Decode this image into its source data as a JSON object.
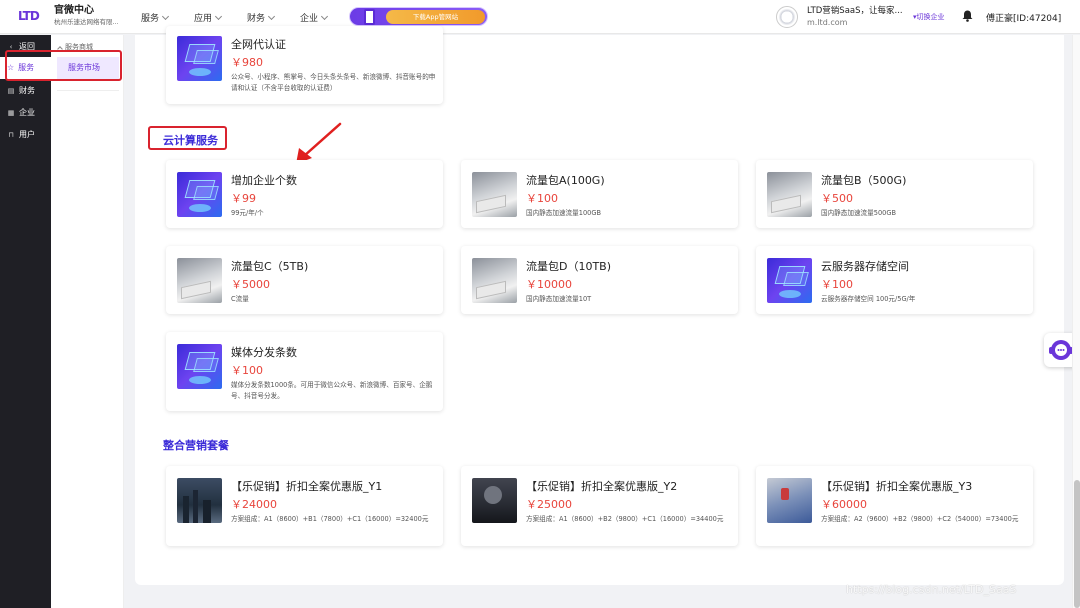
{
  "header": {
    "logo_text": "LTD",
    "title": "官微中心",
    "company_short": "杭州乐速达网络有限...",
    "nav": [
      {
        "label": "服务"
      },
      {
        "label": "应用"
      },
      {
        "label": "财务"
      },
      {
        "label": "企业"
      }
    ],
    "app_banner": "下载App管网站",
    "company_name": "LTD营销SaaS，让每家...",
    "company_domain": "m.ltd.com",
    "switch_label": "▾切换企业",
    "user": "傅正豪[ID:47204]"
  },
  "sidebar": {
    "back_label": "返回",
    "items": [
      {
        "label": "服务",
        "icon": "star-icon"
      },
      {
        "label": "财务",
        "icon": "wallet-icon"
      },
      {
        "label": "企业",
        "icon": "building-icon"
      },
      {
        "label": "用户",
        "icon": "bookmark-icon"
      }
    ]
  },
  "subsidebar": {
    "group": "服务商城",
    "active": "服务市场"
  },
  "sections": {
    "cloud_title": "云计算服务",
    "bundle_title": "整合营销套餐"
  },
  "cards": {
    "cert": {
      "title": "全网代认证",
      "price": "￥980",
      "desc": "公众号、小程序、熊掌号、今日头条头条号、新浪微博、抖音账号的申请和认证（不含平台收取的认证费）"
    },
    "enterprise": {
      "title": "增加企业个数",
      "price": "￥99",
      "desc": "99元/年/个"
    },
    "flow_a": {
      "title": "流量包A(100G)",
      "price": "￥100",
      "desc": "国内静态加速流量100GB"
    },
    "flow_b": {
      "title": "流量包B（500G)",
      "price": "￥500",
      "desc": "国内静态加速流量500GB"
    },
    "flow_c": {
      "title": "流量包C（5TB)",
      "price": "￥5000",
      "desc": "C流量"
    },
    "flow_d": {
      "title": "流量包D（10TB)",
      "price": "￥10000",
      "desc": "国内静态加速流量10T"
    },
    "storage": {
      "title": "云服务器存储空间",
      "price": "￥100",
      "desc": "云服务器存储空间 100元/5G/年"
    },
    "media": {
      "title": "媒体分发条数",
      "price": "￥100",
      "desc": "媒体分发条数1000条。可用于微信公众号、新浪微博、百家号、企鹅号、抖音号分发。"
    },
    "y1": {
      "title": "【乐促销】折扣全案优惠版_Y1",
      "price": "￥24000",
      "desc": "方案组成：A1（8600）+B1（7800）+C1（16000）=32400元"
    },
    "y2": {
      "title": "【乐促销】折扣全案优惠版_Y2",
      "price": "￥25000",
      "desc": "方案组成：A1（8600）+B2（9800）+C1（16000）=34400元"
    },
    "y3": {
      "title": "【乐促销】折扣全案优惠版_Y3",
      "price": "￥60000",
      "desc": "方案组成：A2（9600）+B2（9800）+C2（54000）=73400元"
    }
  },
  "watermark": "https://blog.csdn.net/LTD_SaaS",
  "colors": {
    "accent": "#6a35d9",
    "price": "#e8453c",
    "section": "#3b2bd8",
    "highlight_box": "#d9232e"
  }
}
